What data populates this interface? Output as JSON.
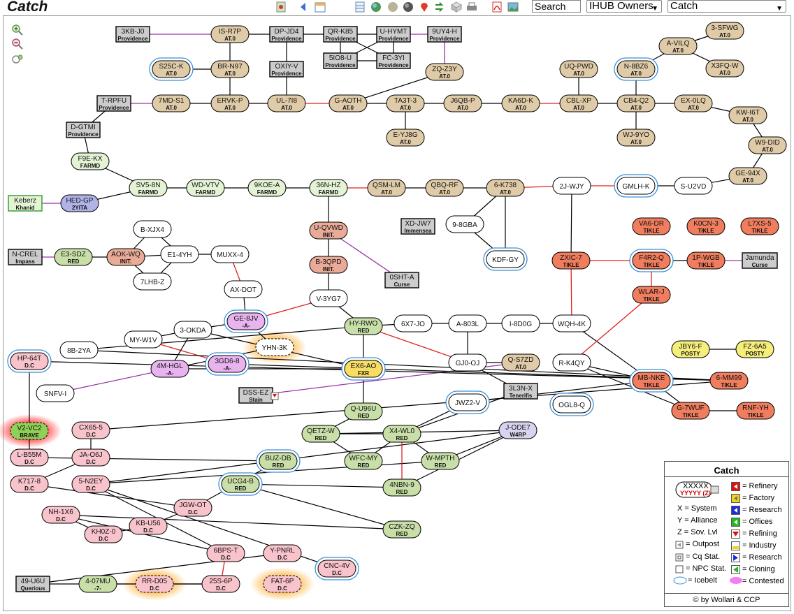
{
  "title": "Catch",
  "search": {
    "value": "Search"
  },
  "owner_select": "IHUB Owners",
  "region_select": "Catch",
  "toolbar": [
    "map-icon",
    "back-icon",
    "calendar-icon",
    "grid-icon",
    "globe-icon",
    "moon-icon",
    "planet-icon",
    "pin-icon",
    "jump-icon",
    "cube-icon",
    "print-icon",
    "pdf-icon",
    "image-icon"
  ],
  "zoom": [
    "zoom-in-icon",
    "zoom-out-icon",
    "zoom-reset-icon"
  ],
  "colors": {
    "at0": "#e0cba8",
    "providence": "#cccccc",
    "farmd": "#e4f3d4",
    "init": "#e9aa98",
    "red": "#c8dfa8",
    "dc": "#f9c3cb",
    "tikle": "#ef7d5e",
    "posty": "#f5ee7a",
    "a": "#e8b4ef",
    "fxr": "#f7dd63",
    "w4rp": "#d9d3f0",
    "yita": "#b0b3e8",
    "npc": "#cfcfcf",
    "white": "#ffffff",
    "line": "#000000",
    "redline": "#e02020",
    "purpleline": "#9a33a8"
  },
  "nodes": [
    {
      "name": "3KB-J0",
      "sub": "Providence"
    },
    {
      "name": "IS-R7P",
      "sub": "AT.0"
    },
    {
      "name": "DP-JD4",
      "sub": "Providence"
    },
    {
      "name": "QR-K85",
      "sub": "Providence"
    },
    {
      "name": "U-HYMT",
      "sub": "Providence"
    },
    {
      "name": "9UY4-H",
      "sub": "Providence"
    },
    {
      "name": "5IO8-U",
      "sub": "Providence"
    },
    {
      "name": "FC-3YI",
      "sub": "Providence"
    },
    {
      "name": "S25C-K",
      "sub": "AT.0"
    },
    {
      "name": "BR-N97",
      "sub": "AT.0"
    },
    {
      "name": "OXIY-V",
      "sub": "Providence"
    },
    {
      "name": "ZQ-Z3Y",
      "sub": "AT.0"
    },
    {
      "name": "3-SFWG",
      "sub": "AT.0"
    },
    {
      "name": "A-VILQ",
      "sub": "AT.0"
    },
    {
      "name": "X3FQ-W",
      "sub": "AT.0"
    },
    {
      "name": "UQ-PWD",
      "sub": "AT.0"
    },
    {
      "name": "N-8BZ6",
      "sub": "AT.0"
    },
    {
      "name": "T-RPFU",
      "sub": "Providence"
    },
    {
      "name": "7MD-S1",
      "sub": "AT.0"
    },
    {
      "name": "ERVK-P",
      "sub": "AT.0"
    },
    {
      "name": "UL-7I8",
      "sub": "AT.0"
    },
    {
      "name": "G-AOTH",
      "sub": "AT.0"
    },
    {
      "name": "TA3T-3",
      "sub": "AT.0"
    },
    {
      "name": "J6QB-P",
      "sub": "AT.0"
    },
    {
      "name": "KA6D-K",
      "sub": "AT.0"
    },
    {
      "name": "CBL-XP",
      "sub": "AT.0"
    },
    {
      "name": "CB4-Q2",
      "sub": "AT.0"
    },
    {
      "name": "EX-0LQ",
      "sub": "AT.0"
    },
    {
      "name": "KW-I6T",
      "sub": "AT.0"
    },
    {
      "name": "E-YJ8G",
      "sub": "AT.0"
    },
    {
      "name": "WJ-9YO",
      "sub": "AT.0"
    },
    {
      "name": "D-GTMI",
      "sub": "Providence"
    },
    {
      "name": "W9-DID",
      "sub": "AT.0"
    },
    {
      "name": "F9E-KX",
      "sub": "FARMD"
    },
    {
      "name": "GE-94X",
      "sub": "AT.0"
    },
    {
      "name": "SV5-8N",
      "sub": "FARMD"
    },
    {
      "name": "WD-VTV",
      "sub": "FARMD"
    },
    {
      "name": "9KOE-A",
      "sub": "FARMD"
    },
    {
      "name": "36N-HZ",
      "sub": "FARMD"
    },
    {
      "name": "QSM-LM",
      "sub": "AT.0"
    },
    {
      "name": "QBQ-RF",
      "sub": "AT.0"
    },
    {
      "name": "6-K738",
      "sub": "AT.0"
    },
    {
      "name": "2J-WJY",
      "sub": ""
    },
    {
      "name": "GMLH-K",
      "sub": ""
    },
    {
      "name": "S-U2VD",
      "sub": ""
    },
    {
      "name": "Keberz",
      "sub": "Khanid"
    },
    {
      "name": "HED-GP",
      "sub": "2YITA"
    },
    {
      "name": "B-XJX4",
      "sub": ""
    },
    {
      "name": "U-QVWD",
      "sub": "INIT."
    },
    {
      "name": "XD-JW7",
      "sub": "Immensea"
    },
    {
      "name": "9-8GBA",
      "sub": ""
    },
    {
      "name": "VA6-DR",
      "sub": "TIKLE"
    },
    {
      "name": "K0CN-3",
      "sub": "TIKLE"
    },
    {
      "name": "L7XS-5",
      "sub": "TIKLE"
    },
    {
      "name": "N-CREL",
      "sub": "Impass"
    },
    {
      "name": "E3-SDZ",
      "sub": "RED"
    },
    {
      "name": "AOK-WQ",
      "sub": "INIT."
    },
    {
      "name": "E1-4YH",
      "sub": ""
    },
    {
      "name": "MUXX-4",
      "sub": ""
    },
    {
      "name": "B-3QPD",
      "sub": "INIT."
    },
    {
      "name": "KDF-GY",
      "sub": ""
    },
    {
      "name": "ZXIC-7",
      "sub": "TIKLE"
    },
    {
      "name": "F4R2-Q",
      "sub": "TIKLE"
    },
    {
      "name": "1P-WGB",
      "sub": "TIKLE"
    },
    {
      "name": "Jamunda",
      "sub": "Curse"
    },
    {
      "name": "7LHB-Z",
      "sub": ""
    },
    {
      "name": "0SHT-A",
      "sub": "Curse"
    },
    {
      "name": "AX-DOT",
      "sub": ""
    },
    {
      "name": "WLAR-J",
      "sub": "TIKLE"
    },
    {
      "name": "V-3YG7",
      "sub": ""
    },
    {
      "name": "GE-8JV",
      "sub": "-A-"
    },
    {
      "name": "HY-RWO",
      "sub": "RED"
    },
    {
      "name": "6X7-JO",
      "sub": ""
    },
    {
      "name": "A-803L",
      "sub": ""
    },
    {
      "name": "I-8D0G",
      "sub": ""
    },
    {
      "name": "WQH-4K",
      "sub": ""
    },
    {
      "name": "3-OKDA",
      "sub": ""
    },
    {
      "name": "MY-W1V",
      "sub": ""
    },
    {
      "name": "YHN-3K",
      "sub": ""
    },
    {
      "name": "JBY6-F",
      "sub": "POSTY"
    },
    {
      "name": "FZ-6A5",
      "sub": "POSTY"
    },
    {
      "name": "HP-64T",
      "sub": "D.C"
    },
    {
      "name": "8B-2YA",
      "sub": ""
    },
    {
      "name": "3GD6-8",
      "sub": "-A-"
    },
    {
      "name": "4M-HGL",
      "sub": "-A-"
    },
    {
      "name": "EX6-AO",
      "sub": "FXR"
    },
    {
      "name": "GJ0-OJ",
      "sub": ""
    },
    {
      "name": "Q-S7ZD",
      "sub": "AT.0"
    },
    {
      "name": "R-K4QY",
      "sub": ""
    },
    {
      "name": "MB-NKE",
      "sub": "TIKLE"
    },
    {
      "name": "6-MM99",
      "sub": "TIKLE"
    },
    {
      "name": "SNFV-I",
      "sub": ""
    },
    {
      "name": "DSS-EZ",
      "sub": "Stain"
    },
    {
      "name": "3L3N-X",
      "sub": "Tenerifis"
    },
    {
      "name": "JWZ2-V",
      "sub": ""
    },
    {
      "name": "OGL8-Q",
      "sub": ""
    },
    {
      "name": "G-7WUF",
      "sub": "TIKLE"
    },
    {
      "name": "RNF-YH",
      "sub": "TIKLE"
    },
    {
      "name": "Q-U96U",
      "sub": "RED"
    },
    {
      "name": "V2-VC2",
      "sub": "BRAVE"
    },
    {
      "name": "CX65-5",
      "sub": "D.C"
    },
    {
      "name": "QETZ-W",
      "sub": "RED"
    },
    {
      "name": "X4-WL0",
      "sub": "RED"
    },
    {
      "name": "J-ODE7",
      "sub": "W4RP"
    },
    {
      "name": "L-B55M",
      "sub": "D.C"
    },
    {
      "name": "JA-O6J",
      "sub": "D.C"
    },
    {
      "name": "WFC-MY",
      "sub": "RED"
    },
    {
      "name": "W-MPTH",
      "sub": "RED"
    },
    {
      "name": "BUZ-DB",
      "sub": "RED"
    },
    {
      "name": "K717-8",
      "sub": "D.C"
    },
    {
      "name": "5-N2EY",
      "sub": "D.C"
    },
    {
      "name": "4NBN-9",
      "sub": "RED"
    },
    {
      "name": "UCG4-B",
      "sub": "RED"
    },
    {
      "name": "JGW-OT",
      "sub": "D.C"
    },
    {
      "name": "NH-1X6",
      "sub": "D.C"
    },
    {
      "name": "KB-U56",
      "sub": "D.C"
    },
    {
      "name": "KH0Z-0",
      "sub": "D.C"
    },
    {
      "name": "CZK-ZQ",
      "sub": "RED"
    },
    {
      "name": "6BPS-T",
      "sub": "D.C"
    },
    {
      "name": "Y-PNRL",
      "sub": "D.C"
    },
    {
      "name": "CNC-4V",
      "sub": "D.C"
    },
    {
      "name": "49-U6U",
      "sub": "Querious"
    },
    {
      "name": "4-07MU",
      "sub": "-7-"
    },
    {
      "name": "RR-D05",
      "sub": "D.C"
    },
    {
      "name": "25S-6P",
      "sub": "D.C"
    },
    {
      "name": "FAT-6P",
      "sub": "D.C"
    }
  ],
  "legend": {
    "title": "Catch",
    "sample_name": "XXXXX",
    "sample_sub": "YYYYY (Z)",
    "left": [
      "X  = System",
      "Y  = Alliance",
      "Z  = Sov. Lvl",
      "= Outpost",
      "= Cq Stat.",
      "= NPC Stat.",
      "= Icebelt"
    ],
    "right": [
      "= Refinery",
      "= Factory",
      "= Research",
      "= Offices",
      "= Refining",
      "= Industry",
      "= Research",
      "= Cloning",
      "= Contested"
    ],
    "copyright": "© by Wollari & CCP"
  }
}
